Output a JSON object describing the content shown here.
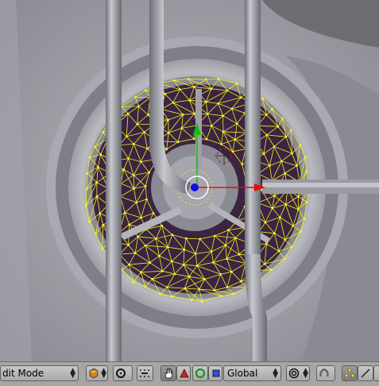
{
  "toolbar": {
    "mode_select": {
      "value": "dit Mode",
      "icon": "select-arrows-icon"
    },
    "draw_type_button": {
      "icon": "shading-cube-icon"
    },
    "pivot_button": {
      "icon": "pivot-icon"
    },
    "widget_toggle": {
      "icon": "hand-icon"
    },
    "translate_manipulator": {
      "icon": "triangle-icon"
    },
    "rotate_manipulator": {
      "icon": "circle-icon"
    },
    "scale_manipulator": {
      "icon": "square-icon"
    },
    "orientation_select": {
      "value": "Global"
    },
    "proportional_edit": {
      "icon": "proportional-icon"
    },
    "snap_button": {
      "icon": "magnet-icon"
    },
    "vertex_select_mode": {
      "icon": "vertex-select-icon"
    },
    "edge_select_mode": {
      "icon": "edge-select-icon"
    }
  },
  "viewport": {
    "mesh_wire_color": "#f0f020",
    "inner_disc_color": "#3b2442",
    "axis_colors": {
      "x": "#e01010",
      "y": "#10c010",
      "z": "#1010e0"
    }
  }
}
